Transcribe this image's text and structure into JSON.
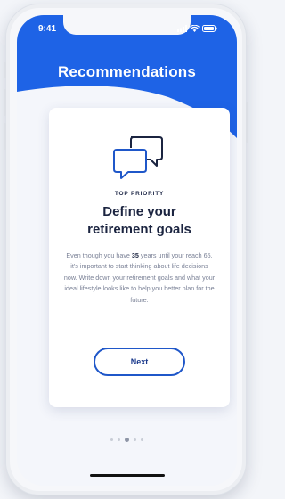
{
  "status_bar": {
    "time": "9:41"
  },
  "header": {
    "title": "Recommendations"
  },
  "card": {
    "icon": "chat-bubbles-icon",
    "label": "TOP PRIORITY",
    "heading_line1": "Define your",
    "heading_line2": "retirement goals",
    "body_before": "Even though you have ",
    "body_years": "35",
    "body_after": " years until your reach 65, it's important to start thinking about life decisions now. Write down your retirement goals and what your ideal lifestyle looks like to help you better plan for the future.",
    "button_label": "Next"
  },
  "pagination": {
    "current": 3,
    "total": 5
  },
  "colors": {
    "accent": "#1f57c9",
    "header_blue": "#1e63e6",
    "text_dark": "#1b2440"
  }
}
